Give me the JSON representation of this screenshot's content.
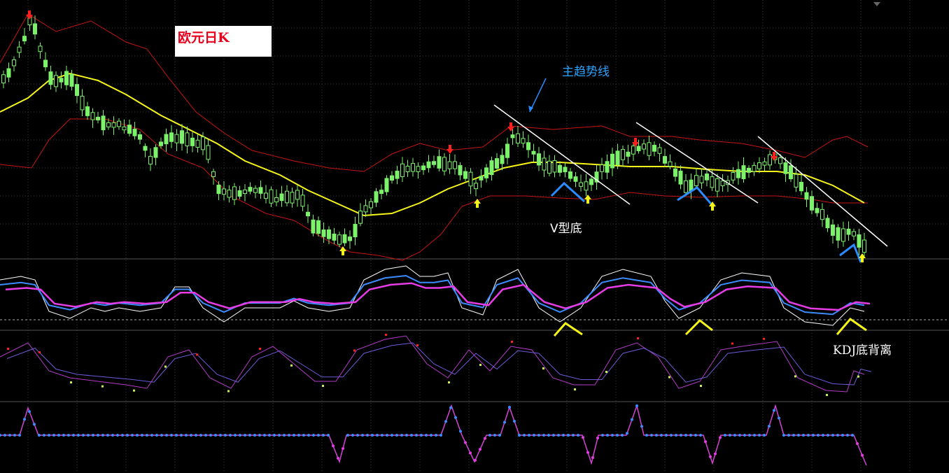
{
  "window": {
    "title_badge": "欧元日K"
  },
  "annotations": {
    "main_trend_line": "主趋势线",
    "v_bottom": "V型底",
    "kdj_divergence": "KDJ底背离"
  },
  "colors": {
    "background": "#000000",
    "grid": "#3a3a3a",
    "bollinger_bands": "#c81414",
    "middle_band": "#f5f519",
    "candle": "#7cf26a",
    "trend_lines": "#ffffff",
    "v_pattern": "#2a8cff",
    "kdj_pattern": "#f5f519",
    "indicator_k": "#ffffff",
    "indicator_d": "#3c8cff",
    "indicator_j": "#e63ce6",
    "sell_arrow": "#ff2020",
    "buy_arrow": "#f5f519"
  },
  "icons": {
    "sell_signal": "red-down-arrow-icon",
    "buy_signal": "yellow-up-arrow-icon"
  }
}
